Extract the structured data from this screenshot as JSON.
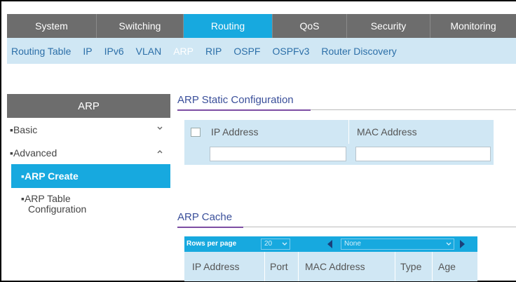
{
  "topnav": {
    "tabs": [
      {
        "label": "System",
        "active": false
      },
      {
        "label": "Switching",
        "active": false
      },
      {
        "label": "Routing",
        "active": true
      },
      {
        "label": "QoS",
        "active": false
      },
      {
        "label": "Security",
        "active": false
      },
      {
        "label": "Monitoring",
        "active": false
      }
    ]
  },
  "subnav": {
    "items": [
      {
        "label": "Routing Table",
        "active": false
      },
      {
        "label": "IP",
        "active": false
      },
      {
        "label": "IPv6",
        "active": false
      },
      {
        "label": "VLAN",
        "active": false
      },
      {
        "label": "ARP",
        "active": true
      },
      {
        "label": "RIP",
        "active": false
      },
      {
        "label": "OSPF",
        "active": false
      },
      {
        "label": "OSPFv3",
        "active": false
      },
      {
        "label": "Router Discovery",
        "active": false
      }
    ]
  },
  "sidebar": {
    "title": "ARP",
    "basic": "Basic",
    "advanced": "Advanced",
    "arp_create": "ARP Create",
    "arp_table_line1": "ARP Table",
    "arp_table_line2": "Configuration"
  },
  "static_config": {
    "title": "ARP Static Configuration",
    "col_ip": "IP Address",
    "col_mac": "MAC Address",
    "ip_value": "",
    "mac_value": ""
  },
  "cache": {
    "title": "ARP Cache",
    "rows_per_page_label": "Rows per page",
    "rows_per_page_value": "20",
    "page_value": "None",
    "columns": [
      "IP Address",
      "Port",
      "MAC Address",
      "Type",
      "Age"
    ]
  },
  "colors": {
    "accent": "#17a9df",
    "nav_gray": "#6d6d6d",
    "light_blue": "#d0e7f4",
    "section_underline": "#7d4ea3"
  }
}
